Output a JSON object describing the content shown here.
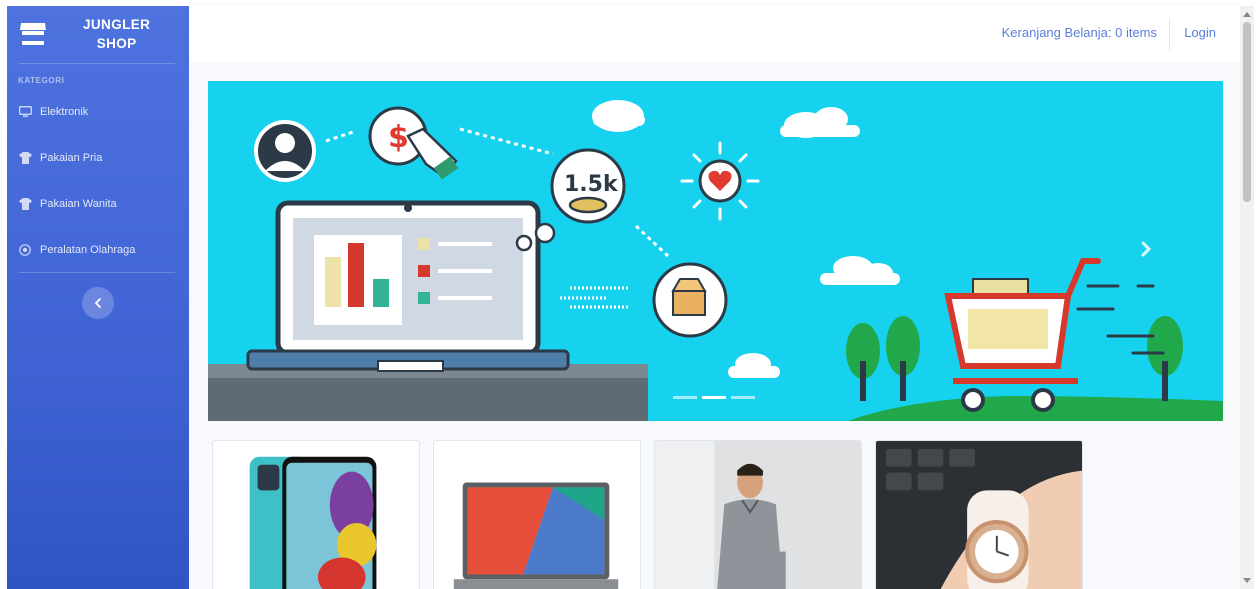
{
  "brand": {
    "line1": "JUNGLER",
    "line2": "SHOP",
    "icon": "store-icon"
  },
  "sidebar": {
    "heading": "KATEGORI",
    "items": [
      {
        "label": "Elektronik",
        "icon": "desktop-icon"
      },
      {
        "label": "Pakaian Pria",
        "icon": "tshirt-icon"
      },
      {
        "label": "Pakaian Wanita",
        "icon": "tshirt-icon"
      },
      {
        "label": "Peralatan Olahraga",
        "icon": "football-icon"
      }
    ],
    "toggle_icon": "chevron-left-icon"
  },
  "topbar": {
    "cart_label": "Keranjang Belanja: 0 items",
    "login_label": "Login"
  },
  "banner": {
    "coin_label": "1.5k",
    "next_icon": "chevron-right-icon"
  },
  "products": [
    {
      "image": "phone-image"
    },
    {
      "image": "laptop-image"
    },
    {
      "image": "shirt-model-image"
    },
    {
      "image": "watch-image"
    }
  ],
  "colors": {
    "sidebar": "#4e73df",
    "banner": "#17d2ef",
    "link": "#5a7fd8"
  }
}
